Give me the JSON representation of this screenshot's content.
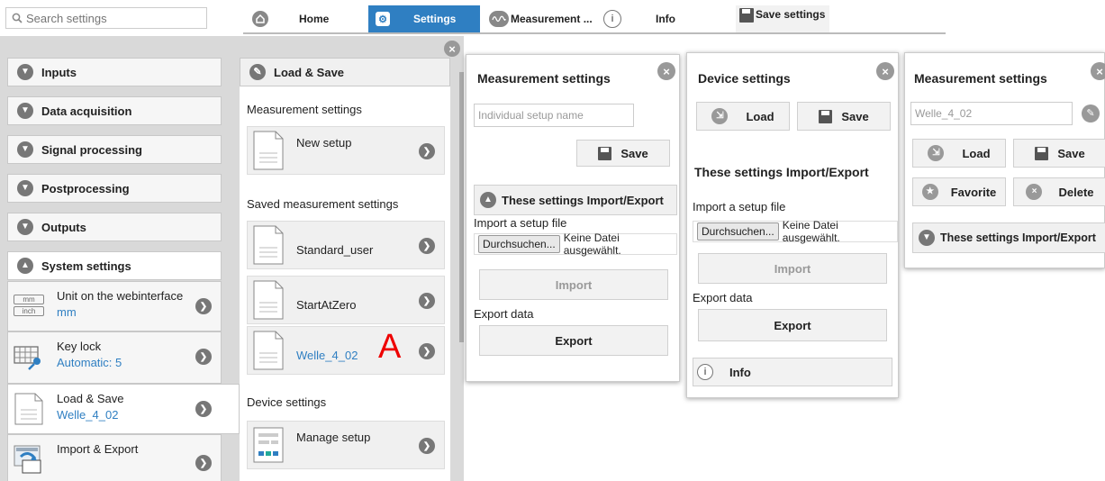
{
  "search": {
    "placeholder": "Search settings"
  },
  "toolbar": {
    "home": "Home",
    "settings": "Settings",
    "measurement": "Measurement ...",
    "info": "Info",
    "save_settings": "Save settings"
  },
  "sidebar": {
    "inputs": "Inputs",
    "data_acquisition": "Data acquisition",
    "signal_processing": "Signal processing",
    "postprocessing": "Postprocessing",
    "outputs": "Outputs",
    "system_settings": "System settings",
    "items": [
      {
        "label": "Unit on the webinterface",
        "value": "mm"
      },
      {
        "label": "Key lock",
        "value": "Automatic: 5"
      },
      {
        "label": "Load & Save",
        "value": "Welle_4_02"
      },
      {
        "label": "Import & Export",
        "value": ""
      }
    ],
    "unit_icon": {
      "mm": "mm",
      "inch": "inch"
    }
  },
  "load_save": {
    "title": "Load & Save",
    "measurement_settings": "Measurement settings",
    "new_setup": "New setup",
    "saved_settings": "Saved measurement settings",
    "saved_items": [
      "Standard_user",
      "StartAtZero",
      "Welle_4_02"
    ],
    "device_settings": "Device settings",
    "manage_setup": "Manage setup"
  },
  "annotation": "A",
  "panel1": {
    "title": "Measurement settings",
    "setup_name_placeholder": "Individual setup name",
    "save": "Save",
    "import_export_header": "These settings Import/Export",
    "import_label": "Import a setup file",
    "browse": "Durchsuchen...",
    "no_file": "Keine Datei ausgewählt.",
    "import": "Import",
    "export_label": "Export data",
    "export": "Export"
  },
  "panel2": {
    "title": "Device settings",
    "load": "Load",
    "save": "Save",
    "import_export_title": "These settings Import/Export",
    "import_label": "Import a setup file",
    "browse": "Durchsuchen...",
    "no_file": "Keine Datei ausgewählt.",
    "import": "Import",
    "export_label": "Export data",
    "export": "Export",
    "info": "Info"
  },
  "panel3": {
    "title": "Measurement settings",
    "setup_name": "Welle_4_02",
    "load": "Load",
    "save": "Save",
    "favorite": "Favorite",
    "delete": "Delete",
    "import_export_header": "These settings Import/Export"
  },
  "colors": {
    "accent": "#2f7fc2",
    "annotation": "#e00000"
  }
}
